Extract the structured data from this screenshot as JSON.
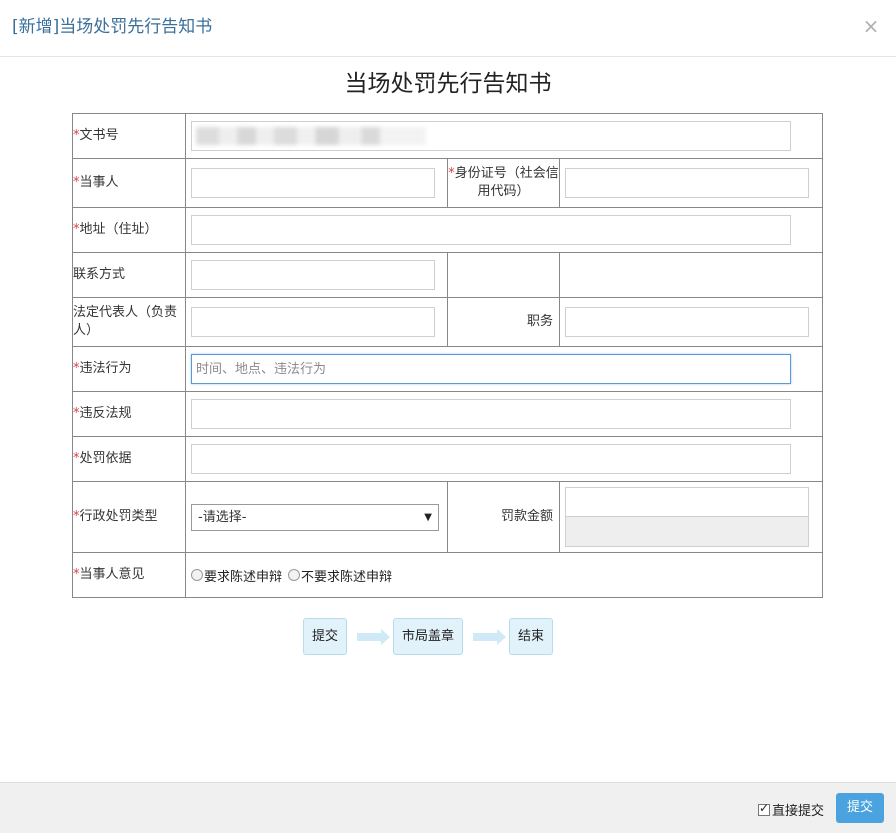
{
  "modal": {
    "title": "[新增]当场处罚先行告知书",
    "close": "×"
  },
  "document": {
    "heading": "当场处罚先行告知书"
  },
  "form": {
    "doc_number": {
      "label": "文书号",
      "value": ""
    },
    "party": {
      "label": "当事人",
      "value": ""
    },
    "id_number": {
      "label": "身份证号（社会信用代码）",
      "value": ""
    },
    "address": {
      "label": "地址（住址）",
      "value": ""
    },
    "contact": {
      "label": "联系方式",
      "value": ""
    },
    "legal_rep": {
      "label": "法定代表人（负责人）",
      "value": ""
    },
    "position": {
      "label": "职务",
      "value": ""
    },
    "violation": {
      "label": "违法行为",
      "value": "",
      "placeholder": "时间、地点、违法行为"
    },
    "law_violated": {
      "label": "违反法规",
      "value": ""
    },
    "penalty_basis": {
      "label": "处罚依据",
      "value": ""
    },
    "penalty_type": {
      "label": "行政处罚类型",
      "selected": "-请选择-"
    },
    "fine_amount": {
      "label": "罚款金额"
    },
    "party_opinion": {
      "label": "当事人意见",
      "options": [
        "要求陈述申辩",
        "不要求陈述申辩"
      ]
    },
    "required_mark": "*"
  },
  "workflow": {
    "steps": [
      "提交",
      "市局盖章",
      "结束"
    ]
  },
  "footer": {
    "direct_submit_label": "直接提交",
    "direct_submit_checked": true,
    "submit_label": "提交"
  },
  "colors": {
    "title_blue": "#3a6f99",
    "required_red": "#e23c3c",
    "submit_blue": "#4aa3df",
    "step_bg": "#e2f2fb"
  }
}
